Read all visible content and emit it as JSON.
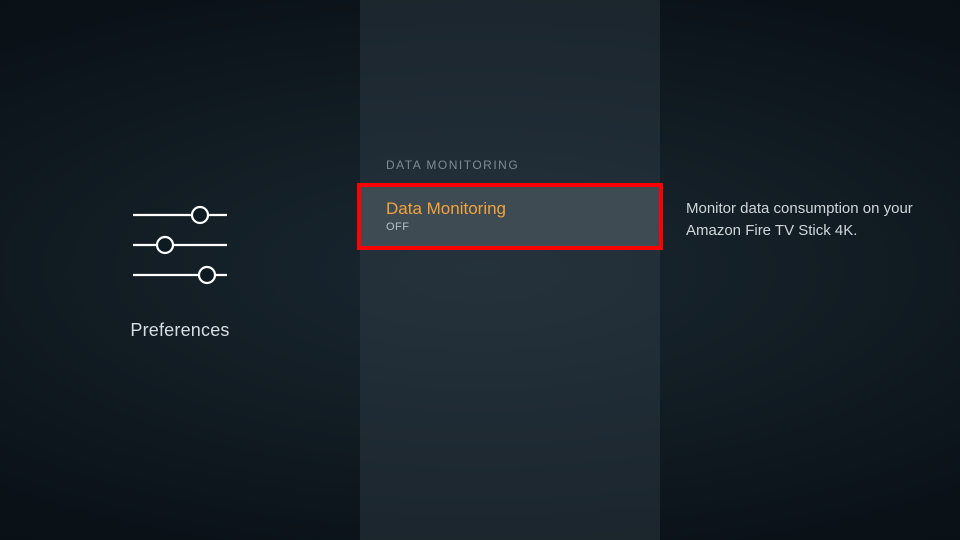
{
  "left": {
    "label": "Preferences"
  },
  "section": {
    "header": "DATA MONITORING",
    "item": {
      "title": "Data Monitoring",
      "state": "OFF"
    }
  },
  "description": "Monitor data consumption on your Amazon Fire TV Stick 4K."
}
